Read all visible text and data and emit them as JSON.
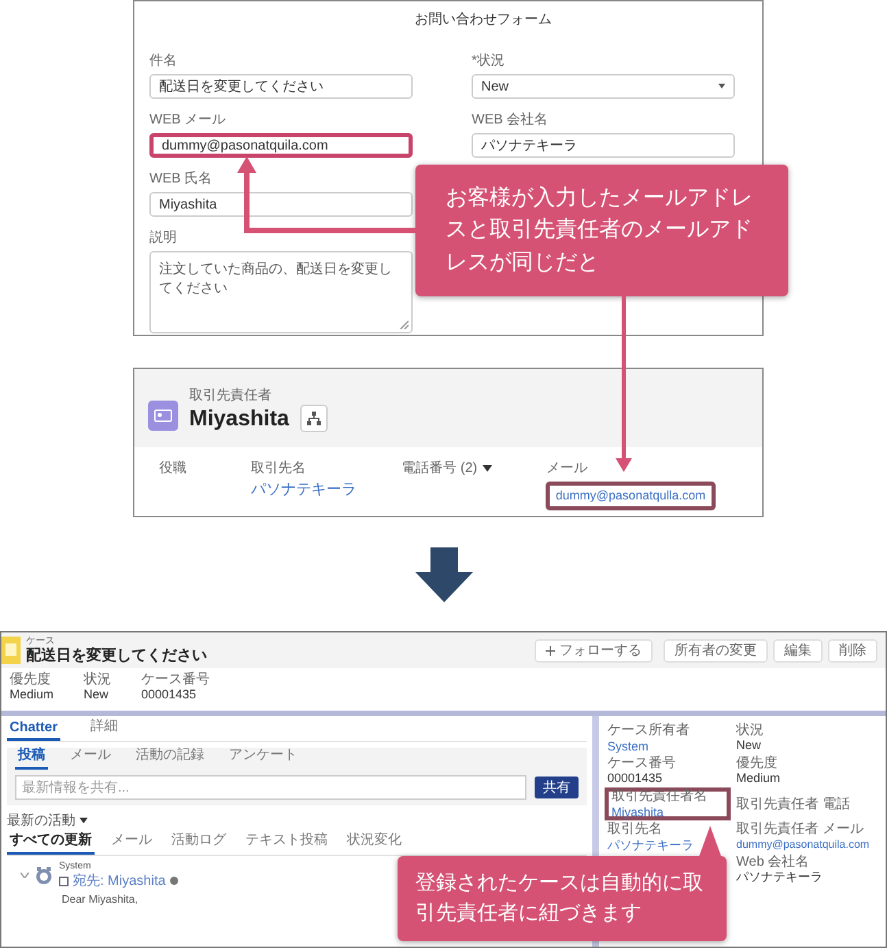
{
  "form": {
    "title": "お問い合わせフォーム",
    "left_fields": [
      {
        "label": "件名",
        "value": "配送日を変更してください",
        "kind": "text",
        "highlighted": false
      },
      {
        "label": "WEB メール",
        "value": "dummy@pasonatquila.com",
        "kind": "text",
        "highlighted": true
      },
      {
        "label": "WEB 氏名",
        "value": "Miyashita",
        "kind": "text",
        "highlighted": false
      },
      {
        "label": "説明",
        "value": "注文していた商品の、配送日を変更してください",
        "kind": "textarea",
        "highlighted": false
      }
    ],
    "right_fields": [
      {
        "label": "*状況",
        "value": "New",
        "kind": "select",
        "highlighted": false
      },
      {
        "label": "WEB 会社名",
        "value": "パソナテキーラ",
        "kind": "text",
        "highlighted": false
      }
    ]
  },
  "contact_card": {
    "object_label": "取引先責任者",
    "name": "Miyashita",
    "columns": [
      {
        "label": "役職"
      },
      {
        "label": "取引先名",
        "value": "パソナテキーラ"
      },
      {
        "label": "電話番号 (2)",
        "dropdown": true
      },
      {
        "label": "メール",
        "value": "dummy@pasonatqulla.com",
        "highlighted": true
      }
    ]
  },
  "case": {
    "object_label": "ケース",
    "title": "配送日を変更してください",
    "actions": [
      {
        "label": "フォローする"
      },
      {
        "label": "所有者の変更"
      },
      {
        "label": "編集"
      },
      {
        "label": "削除"
      }
    ],
    "highlights": [
      {
        "label": "優先度",
        "value": "Medium"
      },
      {
        "label": "状況",
        "value": "New"
      },
      {
        "label": "ケース番号",
        "value": "00001435"
      }
    ],
    "tabs": [
      {
        "label": "Chatter",
        "selected": true
      },
      {
        "label": "詳細",
        "selected": false
      }
    ],
    "publisher_tabs": [
      {
        "label": "投稿",
        "selected": true
      },
      {
        "label": "メール",
        "selected": false
      },
      {
        "label": "活動の記録",
        "selected": false
      },
      {
        "label": "アンケート",
        "selected": false
      }
    ],
    "share_placeholder": "最新情報を共有...",
    "share_button": "共有",
    "sort": "最新の活動",
    "feed_filters": [
      {
        "label": "すべての更新",
        "selected": true
      },
      {
        "label": "メール",
        "selected": false
      },
      {
        "label": "活動ログ",
        "selected": false
      },
      {
        "label": "テキスト投稿",
        "selected": false
      },
      {
        "label": "状況変化",
        "selected": false
      }
    ],
    "feed_item": {
      "author": "System",
      "recipient": "宛先: Miyashita",
      "body": "Dear Miyashita,"
    },
    "left_details": [
      {
        "label": "ケース所有者",
        "value": "System",
        "link": true,
        "highlighted": false
      },
      {
        "label": "ケース番号",
        "value": "00001435",
        "link": false,
        "highlighted": false
      },
      {
        "label": "取引先責任者名",
        "value": "Miyashita",
        "link": true,
        "highlighted": true
      },
      {
        "label": "取引先名",
        "value": "パソナテキーラ",
        "link": true,
        "highlighted": false
      }
    ],
    "right_details": [
      {
        "label": "状況",
        "value": "New",
        "link": false,
        "highlighted": false
      },
      {
        "label": "優先度",
        "value": "Medium",
        "link": false,
        "highlighted": false
      },
      {
        "label": "取引先責任者 電話",
        "highlighted": false
      },
      {
        "label": "取引先責任者 メール",
        "value": "dummy@pasonatquila.com",
        "link": true,
        "highlighted": false
      },
      {
        "label": "Web 会社名",
        "value": "パソナテキーラ",
        "link": false,
        "highlighted": false
      }
    ]
  },
  "callouts": [
    {
      "text": "お客様が入力したメールアドレスと取引先責任者のメールアドレスが同じだと"
    },
    {
      "text": "登録されたケースは自動的に取引先責任者に紐づきます"
    }
  ]
}
